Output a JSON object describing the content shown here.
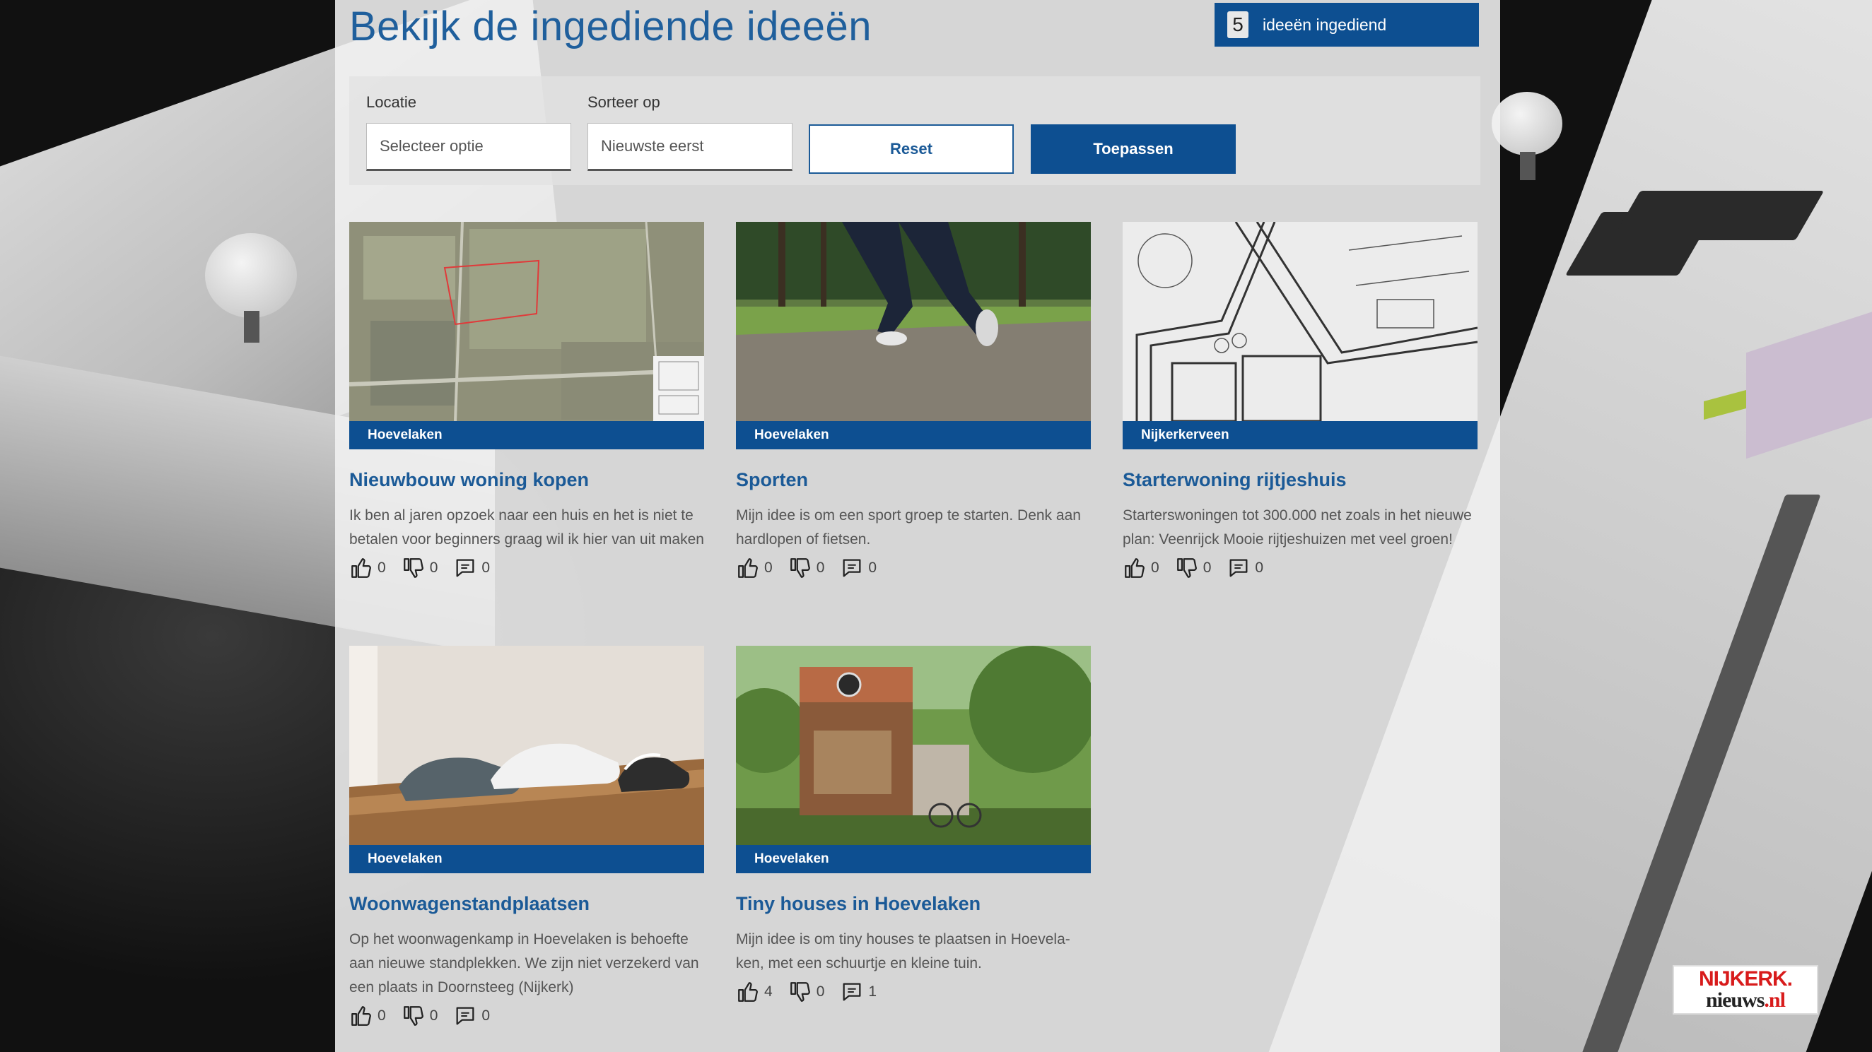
{
  "header": {
    "title": "Bekijk de ingediende ideeën",
    "count": "5",
    "count_label": "ideeën ingediend"
  },
  "filters": {
    "location_label": "Locatie",
    "location_value": "Selecteer optie",
    "sort_label": "Sorteer op",
    "sort_value": "Nieuwste eerst",
    "reset_label": "Reset",
    "apply_label": "Toepassen"
  },
  "ideas": [
    {
      "location": "Hoevelaken",
      "title": "Nieuwbouw woning kopen",
      "description": "Ik ben al jaren opzoek naar een huis en het is niet te betalen voor beginners graag wil ik hier van uit maken",
      "likes": "0",
      "dislikes": "0",
      "comments": "0",
      "image": "aerial-map"
    },
    {
      "location": "Hoevelaken",
      "title": "Sporten",
      "description": "Mijn idee is om een sport groep te starten. Denk aan hardlopen of fietsen.",
      "likes": "0",
      "dislikes": "0",
      "comments": "0",
      "image": "runner"
    },
    {
      "location": "Nijkerkerveen",
      "title": "Starterwoning rijtjeshuis",
      "description": "Starterswoningen tot 300.000 net zoals in het nieuwe plan: Veenrijck Mooie rijtjeshuizen met veel groen!",
      "likes": "0",
      "dislikes": "0",
      "comments": "0",
      "image": "floor-plan"
    },
    {
      "location": "Hoevelaken",
      "title": "Woonwagenstandplaatsen",
      "description": "Op het woonwagenkamp in Hoevelaken is behoefte aan nieuwe standplekken. We zijn niet verzekerd van een plaats in Doornsteeg (Nijkerk)",
      "likes": "0",
      "dislikes": "0",
      "comments": "0",
      "image": "shoes-on-doormat"
    },
    {
      "location": "Hoevelaken",
      "title": "Tiny houses in Hoevelaken",
      "description": "Mijn idee is om tiny houses te plaatsen in Hoevela-ken, met een schuurtje en kleine tuin.",
      "likes": "4",
      "dislikes": "0",
      "comments": "1",
      "image": "tiny-house"
    }
  ],
  "icons": {
    "like": "thumbs-up-icon",
    "dislike": "thumbs-down-icon",
    "comment": "comment-icon"
  },
  "logo": {
    "line1": "NIJKERK.",
    "line2a": "nieuws",
    "line2b": ".nl"
  },
  "colors": {
    "primary": "#0d4f91",
    "title": "#1b5a97",
    "logo_red": "#d81b1b"
  }
}
